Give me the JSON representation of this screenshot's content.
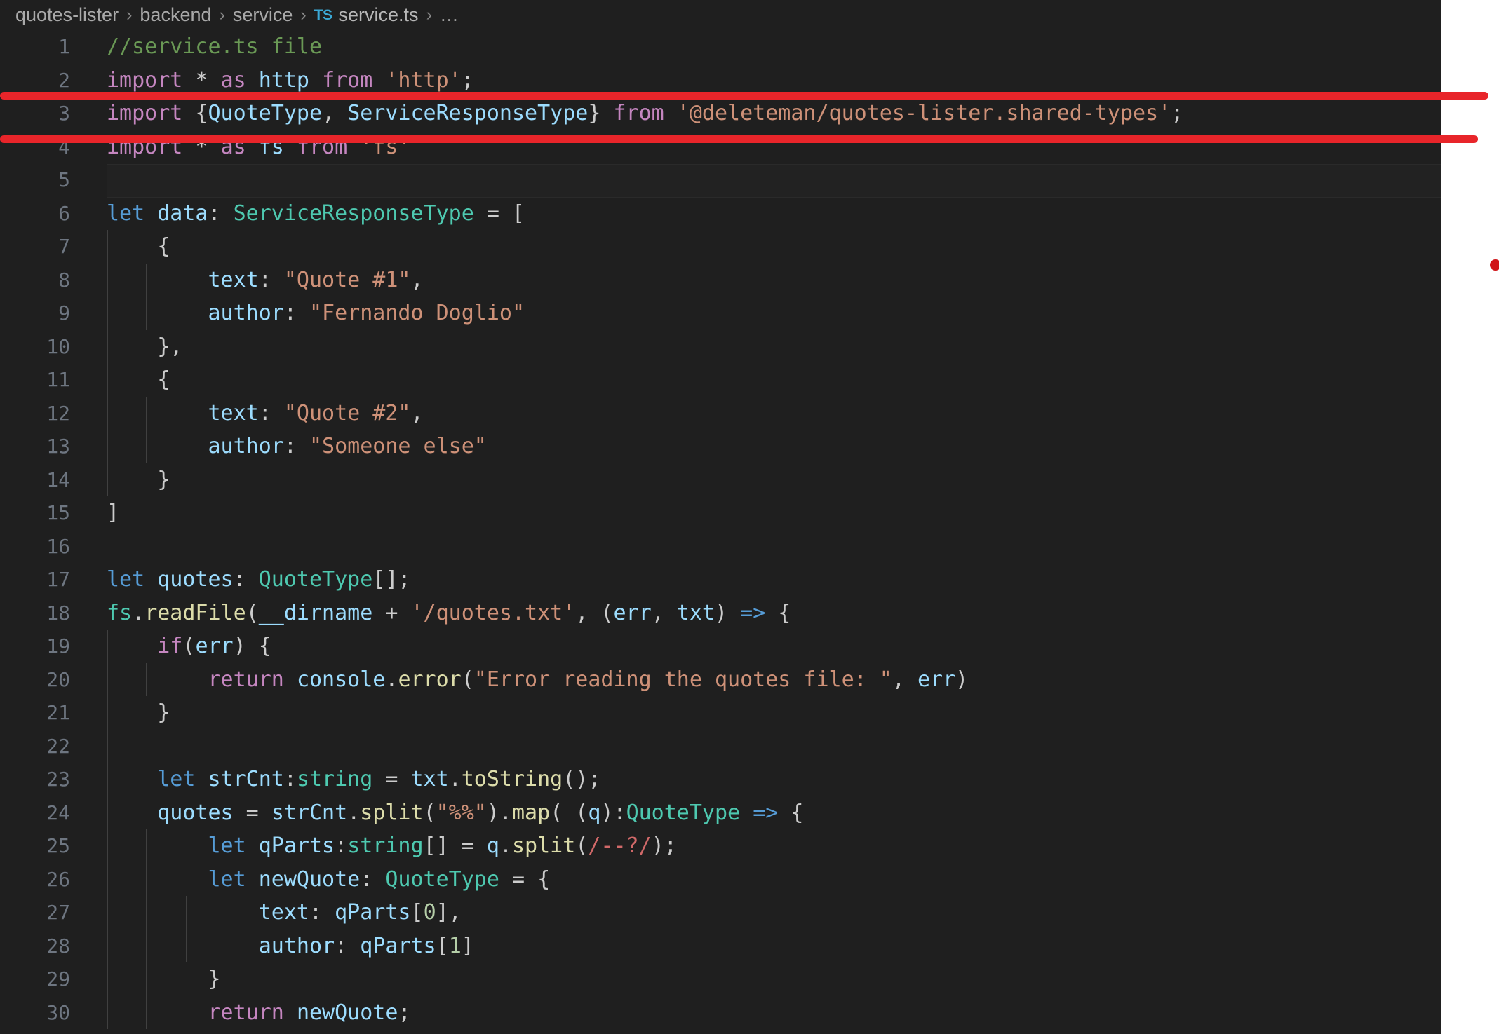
{
  "window": {
    "app": "Visual Studio Code",
    "theme_background": "#1f1f1f",
    "accent_red": "#e8252a"
  },
  "breadcrumb": {
    "name": "breadcrumb",
    "segments": [
      "quotes-lister",
      "backend",
      "service"
    ],
    "separator": "›",
    "file_icon_label": "TS",
    "file": "service.ts",
    "ellipsis": "…"
  },
  "annotations": {
    "top_line_label": "red-underline-above-line-3",
    "bottom_line_label": "red-underline-below-line-3",
    "dot_label": "red-dot-marker",
    "color": "#e8252a"
  },
  "editor": {
    "language": "TypeScript",
    "file_name": "service.ts",
    "first_visible_line": 1,
    "last_visible_line": 30,
    "current_line": 5,
    "line_numbers": [
      1,
      2,
      3,
      4,
      5,
      6,
      7,
      8,
      9,
      10,
      11,
      12,
      13,
      14,
      15,
      16,
      17,
      18,
      19,
      20,
      21,
      22,
      23,
      24,
      25,
      26,
      27,
      28,
      29,
      30
    ],
    "lines": [
      {
        "n": 1,
        "text": "//service.ts file"
      },
      {
        "n": 2,
        "text": "import * as http from 'http';"
      },
      {
        "n": 3,
        "text": "import {QuoteType, ServiceResponseType} from '@deleteman/quotes-lister.shared-types';"
      },
      {
        "n": 4,
        "text": "import * as fs from 'fs'"
      },
      {
        "n": 5,
        "text": ""
      },
      {
        "n": 6,
        "text": "let data: ServiceResponseType = ["
      },
      {
        "n": 7,
        "text": "    {"
      },
      {
        "n": 8,
        "text": "        text: \"Quote #1\","
      },
      {
        "n": 9,
        "text": "        author: \"Fernando Doglio\""
      },
      {
        "n": 10,
        "text": "    },"
      },
      {
        "n": 11,
        "text": "    {"
      },
      {
        "n": 12,
        "text": "        text: \"Quote #2\","
      },
      {
        "n": 13,
        "text": "        author: \"Someone else\""
      },
      {
        "n": 14,
        "text": "    }"
      },
      {
        "n": 15,
        "text": "]"
      },
      {
        "n": 16,
        "text": ""
      },
      {
        "n": 17,
        "text": "let quotes: QuoteType[];"
      },
      {
        "n": 18,
        "text": "fs.readFile(__dirname + '/quotes.txt', (err, txt) => {"
      },
      {
        "n": 19,
        "text": "    if(err) {"
      },
      {
        "n": 20,
        "text": "        return console.error(\"Error reading the quotes file: \", err)"
      },
      {
        "n": 21,
        "text": "    }"
      },
      {
        "n": 22,
        "text": ""
      },
      {
        "n": 23,
        "text": "    let strCnt:string = txt.toString();"
      },
      {
        "n": 24,
        "text": "    quotes = strCnt.split(\"%%\").map( (q):QuoteType => {"
      },
      {
        "n": 25,
        "text": "        let qParts:string[] = q.split(/--?/);"
      },
      {
        "n": 26,
        "text": "        let newQuote: QuoteType = {"
      },
      {
        "n": 27,
        "text": "            text: qParts[0],"
      },
      {
        "n": 28,
        "text": "            author: qParts[1]"
      },
      {
        "n": 29,
        "text": "        }"
      },
      {
        "n": 30,
        "text": "        return newQuote;"
      }
    ]
  },
  "syntax_colors": {
    "comment": "#6a9955",
    "keyword": "#c586c0",
    "storage": "#569cd6",
    "string": "#ce9178",
    "type": "#4ec9b0",
    "variable": "#9cdcfe",
    "function": "#dcdcaa",
    "number": "#b5cea8",
    "regex": "#d16969",
    "plain": "#cccccc",
    "line_number": "#6e7681"
  }
}
